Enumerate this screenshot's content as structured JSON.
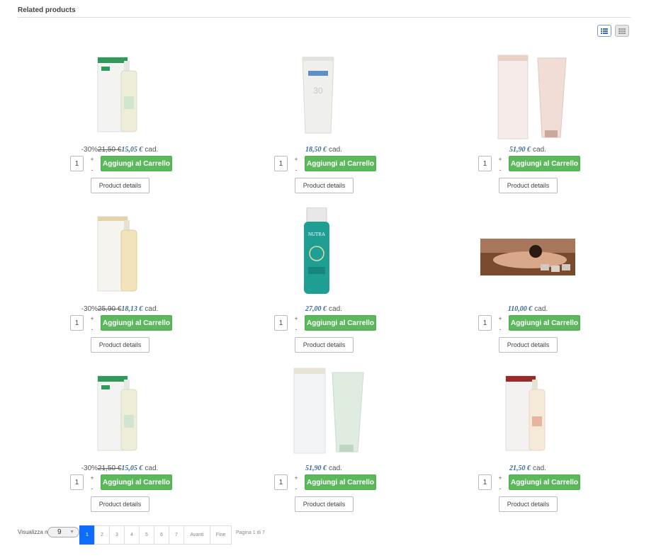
{
  "section_title": "Related products",
  "view_toggle": {
    "list_icon": "list-view-icon",
    "grid_icon": "grid-view-icon"
  },
  "colors": {
    "add_button": "#5cb85c",
    "price": "#3a6a9a",
    "page_active": "#0d6efd"
  },
  "products": [
    {
      "image": "bottle-green-box",
      "discount": "-30%",
      "old_price": "21,50 €",
      "price": "15,05 €",
      "unit": "cad.",
      "qty": "1",
      "add_label": "Aggiungi al Carrello",
      "details_label": "Product details"
    },
    {
      "image": "tube-white",
      "discount": "",
      "old_price": "",
      "price": "18,50 €",
      "unit": "cad.",
      "qty": "1",
      "add_label": "Aggiungi al Carrello",
      "details_label": "Product details"
    },
    {
      "image": "tube-pink-box",
      "discount": "",
      "old_price": "",
      "price": "51,90 €",
      "unit": "cad.",
      "qty": "1",
      "add_label": "Aggiungi al Carrello",
      "details_label": "Product details"
    },
    {
      "image": "bottle-cream-box",
      "discount": "-30%",
      "old_price": "25,90 €",
      "price": "18,13 €",
      "unit": "cad.",
      "qty": "1",
      "add_label": "Aggiungi al Carrello",
      "details_label": "Product details"
    },
    {
      "image": "bottle-teal",
      "discount": "",
      "old_price": "",
      "price": "27,00 €",
      "unit": "cad.",
      "qty": "1",
      "add_label": "Aggiungi al Carrello",
      "details_label": "Product details"
    },
    {
      "image": "spa-massage-photo",
      "discount": "",
      "old_price": "",
      "price": "110,00 €",
      "unit": "cad.",
      "qty": "1",
      "add_label": "Aggiungi al Carrello",
      "details_label": "Product details"
    },
    {
      "image": "bottle-green-box",
      "discount": "-30%",
      "old_price": "21,50 €",
      "price": "15,05 €",
      "unit": "cad.",
      "qty": "1",
      "add_label": "Aggiungi al Carrello",
      "details_label": "Product details"
    },
    {
      "image": "tube-mint-box",
      "discount": "",
      "old_price": "",
      "price": "51,90 €",
      "unit": "cad.",
      "qty": "1",
      "add_label": "Aggiungi al Carrello",
      "details_label": "Product details"
    },
    {
      "image": "bottle-red-box",
      "discount": "",
      "old_price": "",
      "price": "21,50 €",
      "unit": "cad.",
      "qty": "1",
      "add_label": "Aggiungi al Carrello",
      "details_label": "Product details"
    }
  ],
  "pagination": {
    "label": "Visualizza n.",
    "per_page": "9",
    "pages": [
      "1",
      "2",
      "3",
      "4",
      "5",
      "6",
      "7"
    ],
    "active_page": "1",
    "next_label": "Avanti",
    "end_label": "Fine",
    "info": "Pagina 1 di 7"
  }
}
